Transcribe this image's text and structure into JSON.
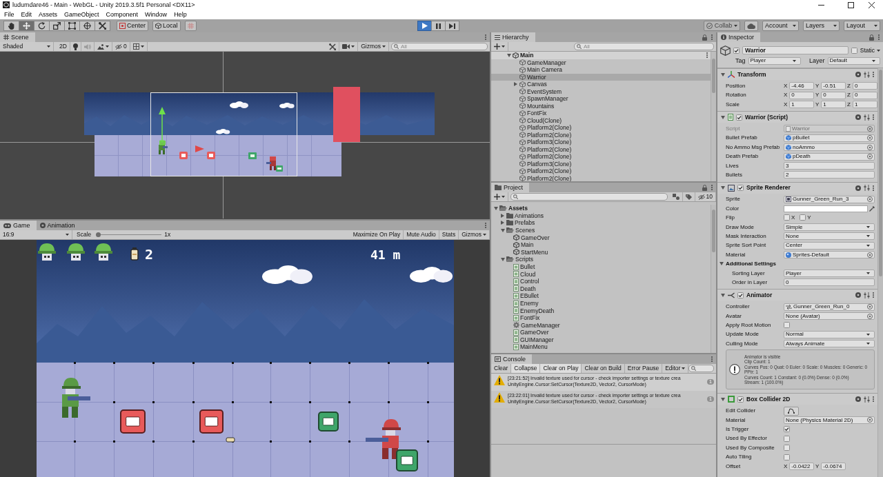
{
  "window": {
    "title": "ludumdare46 - Main - WebGL - Unity 2019.3.5f1 Personal <DX11>"
  },
  "menu": [
    "File",
    "Edit",
    "Assets",
    "GameObject",
    "Component",
    "Window",
    "Help"
  ],
  "toolbar": {
    "tools": [
      {
        "kind": "hand",
        "selected": false
      },
      {
        "kind": "move",
        "selected": true
      },
      {
        "kind": "rotate",
        "selected": false
      },
      {
        "kind": "scale",
        "selected": false
      },
      {
        "kind": "rect",
        "selected": false
      },
      {
        "kind": "transform",
        "selected": false
      },
      {
        "kind": "custom",
        "selected": false
      }
    ],
    "pivot": "Center",
    "space": "Local",
    "playback": [
      {
        "kind": "play",
        "on": true
      },
      {
        "kind": "pause",
        "on": false
      },
      {
        "kind": "step",
        "on": false
      }
    ],
    "collab": {
      "label": "Collab",
      "disabled": true
    },
    "account": "Account",
    "layers": "Layers",
    "layout": "Layout"
  },
  "scene": {
    "tab": "Scene",
    "shading": "Shaded",
    "mode_2d": "2D",
    "lighting": {
      "on": true
    },
    "audio": {
      "on": false
    },
    "hidden_count": "0",
    "gizmos": "Gizmos",
    "search_placeholder": "All"
  },
  "game": {
    "tabs": [
      {
        "label": "Game",
        "selected": true
      },
      {
        "label": "Animation",
        "selected": false
      }
    ],
    "aspect": "16:9",
    "scale_label": "Scale",
    "scale": {
      "level": 0
    },
    "scale_reading": "1x",
    "toggles": [
      {
        "label": "Maximize On Play",
        "on": false
      },
      {
        "label": "Mute Audio",
        "on": false
      },
      {
        "label": "Stats",
        "on": false
      }
    ],
    "gizmos": "Gizmos",
    "hud": {
      "ammo": "2",
      "distance": "41 m"
    }
  },
  "hierarchy": {
    "tab": "Hierarchy",
    "search_placeholder": "All",
    "items": [
      {
        "kind": "scene",
        "label": "Main",
        "expanded": true,
        "selected": false,
        "children": [
          {
            "kind": "object",
            "label": "GameManager",
            "selected": false
          },
          {
            "kind": "object",
            "label": "Main Camera",
            "selected": false
          },
          {
            "kind": "object",
            "label": "Warrior",
            "selected": true
          },
          {
            "kind": "object",
            "label": "Canvas",
            "expanded": false,
            "selected": false
          },
          {
            "kind": "object",
            "label": "EventSystem",
            "selected": false
          },
          {
            "kind": "object",
            "label": "SpawnManager",
            "selected": false
          },
          {
            "kind": "object",
            "label": "Mountains",
            "selected": false
          },
          {
            "kind": "object",
            "label": "FontFix",
            "selected": false
          },
          {
            "kind": "object",
            "label": "Cloud(Clone)",
            "selected": false
          },
          {
            "kind": "object",
            "label": "Platform2(Clone)",
            "selected": false
          },
          {
            "kind": "object",
            "label": "Platform2(Clone)",
            "selected": false
          },
          {
            "kind": "object",
            "label": "Platform3(Clone)",
            "selected": false
          },
          {
            "kind": "object",
            "label": "Platform2(Clone)",
            "selected": false
          },
          {
            "kind": "object",
            "label": "Platform2(Clone)",
            "selected": false
          },
          {
            "kind": "object",
            "label": "Platform3(Clone)",
            "selected": false
          },
          {
            "kind": "object",
            "label": "Platform2(Clone)",
            "selected": false
          },
          {
            "kind": "object",
            "label": "Platform2(Clone)",
            "selected": false
          }
        ]
      }
    ]
  },
  "project": {
    "tab": "Project",
    "hidden_count": "10",
    "items": [
      {
        "kind": "folder",
        "label": "Assets",
        "expanded": true,
        "children": [
          {
            "kind": "folder",
            "label": "Animations",
            "expanded": false
          },
          {
            "kind": "folder",
            "label": "Prefabs",
            "expanded": false
          },
          {
            "kind": "folder",
            "label": "Scenes",
            "expanded": true,
            "children": [
              {
                "kind": "scene",
                "label": "GameOver"
              },
              {
                "kind": "scene",
                "label": "Main"
              },
              {
                "kind": "scene",
                "label": "StartMenu"
              }
            ]
          },
          {
            "kind": "folder",
            "label": "Scripts",
            "expanded": true,
            "children": [
              {
                "kind": "script",
                "label": "Bullet"
              },
              {
                "kind": "script",
                "label": "Cloud"
              },
              {
                "kind": "script",
                "label": "Control"
              },
              {
                "kind": "script",
                "label": "Death"
              },
              {
                "kind": "script",
                "label": "EBullet"
              },
              {
                "kind": "script",
                "label": "Enemy"
              },
              {
                "kind": "script",
                "label": "EnemyDeath"
              },
              {
                "kind": "script",
                "label": "FontFix"
              },
              {
                "kind": "manager",
                "label": "GameManager"
              },
              {
                "kind": "script",
                "label": "GameOver"
              },
              {
                "kind": "script",
                "label": "GUIManager"
              },
              {
                "kind": "script",
                "label": "MainMenu"
              }
            ]
          }
        ]
      }
    ]
  },
  "console": {
    "tab": "Console",
    "buttons": [
      {
        "label": "Clear",
        "on": false
      },
      {
        "label": "Collapse",
        "on": true
      },
      {
        "label": "Clear on Play",
        "on": true
      },
      {
        "label": "Clear on Build",
        "on": false
      },
      {
        "label": "Error Pause",
        "on": false
      }
    ],
    "filter": "Editor",
    "messages": [
      {
        "kind": "warning",
        "text": "[23:21:52] Invalid texture used for cursor - check importer settings or texture crea",
        "trace": "UnityEngine.Cursor:SetCursor(Texture2D, Vector2, CursorMode)",
        "count": "1"
      },
      {
        "kind": "warning",
        "text": "[23:22:01] Invalid texture used for cursor - check importer settings or texture crea",
        "trace": "UnityEngine.Cursor:SetCursor(Texture2D, Vector2, CursorMode)",
        "count": "1"
      }
    ]
  },
  "inspector": {
    "tab": "Inspector",
    "object": {
      "active": true,
      "name": "Warrior",
      "static": false,
      "static_label": "Static",
      "tag_label": "Tag",
      "tag": "Player",
      "layer_label": "Layer",
      "layer": "Default"
    },
    "components": [
      {
        "kind": "transform",
        "title": "Transform",
        "expanded": true,
        "fields": [
          {
            "kind": "vector",
            "label": "Position",
            "parts": [
              {
                "axis": "X",
                "value": "-4.46"
              },
              {
                "axis": "Y",
                "value": "-0.51"
              },
              {
                "axis": "Z",
                "value": "0"
              }
            ]
          },
          {
            "kind": "vector",
            "label": "Rotation",
            "parts": [
              {
                "axis": "X",
                "value": "0"
              },
              {
                "axis": "Y",
                "value": "0"
              },
              {
                "axis": "Z",
                "value": "0"
              }
            ]
          },
          {
            "kind": "vector",
            "label": "Scale",
            "parts": [
              {
                "axis": "X",
                "value": "1"
              },
              {
                "axis": "Y",
                "value": "1"
              },
              {
                "axis": "Z",
                "value": "1"
              }
            ]
          }
        ]
      },
      {
        "kind": "script",
        "title": "Warrior (Script)",
        "enabled": true,
        "expanded": true,
        "fields": [
          {
            "kind": "object",
            "label": "Script",
            "ref": {
              "kind": "script",
              "name": "Warrior"
            },
            "disabled": true
          },
          {
            "kind": "object",
            "label": "Bullet Prefab",
            "ref": {
              "kind": "prefab",
              "name": "pBullet"
            },
            "disabled": false
          },
          {
            "kind": "object",
            "label": "No Ammo Msg Prefab",
            "ref": {
              "kind": "prefab",
              "name": "noAmmo"
            },
            "disabled": false
          },
          {
            "kind": "object",
            "label": "Death Prefab",
            "ref": {
              "kind": "prefab",
              "name": "pDeath"
            },
            "disabled": false
          },
          {
            "kind": "text",
            "label": "Lives",
            "value": "3"
          },
          {
            "kind": "text",
            "label": "Bullets",
            "value": "2"
          }
        ]
      },
      {
        "kind": "sprite",
        "title": "Sprite Renderer",
        "enabled": true,
        "expanded": true,
        "fields": [
          {
            "kind": "object",
            "label": "Sprite",
            "ref": {
              "kind": "sprite",
              "name": "Gunner_Green_Run_3"
            },
            "disabled": false
          },
          {
            "kind": "color",
            "label": "Color",
            "color": "#ffffff"
          },
          {
            "kind": "flip",
            "label": "Flip",
            "options": [
              {
                "label": "X",
                "checked": false
              },
              {
                "label": "Y",
                "checked": false
              }
            ]
          },
          {
            "kind": "dropdown",
            "label": "Draw Mode",
            "value": "Simple"
          },
          {
            "kind": "dropdown",
            "label": "Mask Interaction",
            "value": "None"
          },
          {
            "kind": "dropdown",
            "label": "Sprite Sort Point",
            "value": "Center"
          },
          {
            "kind": "object",
            "label": "Material",
            "ref": {
              "kind": "material",
              "name": "Sprites-Default"
            },
            "disabled": false
          },
          {
            "kind": "foldout",
            "label": "Additional Settings",
            "expanded": true,
            "children": [
              {
                "kind": "dropdown",
                "label": "Sorting Layer",
                "value": "Player"
              },
              {
                "kind": "text",
                "label": "Order in Layer",
                "value": "0"
              }
            ]
          }
        ]
      },
      {
        "kind": "animator",
        "title": "Animator",
        "enabled": true,
        "expanded": true,
        "fields": [
          {
            "kind": "object",
            "label": "Controller",
            "ref": {
              "kind": "controller",
              "name": "Gunner_Green_Run_0"
            },
            "disabled": false
          },
          {
            "kind": "object",
            "label": "Avatar",
            "ref": {
              "kind": "none",
              "name": "None (Avatar)"
            },
            "disabled": false
          },
          {
            "kind": "checkbox",
            "label": "Apply Root Motion",
            "checked": false
          },
          {
            "kind": "dropdown",
            "label": "Update Mode",
            "value": "Normal"
          },
          {
            "kind": "dropdown",
            "label": "Culling Mode",
            "value": "Always Animate"
          },
          {
            "kind": "info",
            "lines": [
              "Animator is visible",
              "Clip Count: 1",
              "Curves Pos: 0 Quat: 0 Euler: 0 Scale: 0 Muscles: 0 Generic: 0 PPtr: 1",
              "Curves Count: 1 Constant: 0 (0.0%) Dense: 0 (0.0%)",
              "Stream: 1 (100.0%)"
            ]
          }
        ]
      },
      {
        "kind": "collider",
        "title": "Box Collider 2D",
        "enabled": true,
        "expanded": true,
        "fields": [
          {
            "kind": "button",
            "label": "Edit Collider"
          },
          {
            "kind": "object",
            "label": "Material",
            "ref": {
              "kind": "none",
              "name": "None (Physics Material 2D)"
            },
            "disabled": false
          },
          {
            "kind": "checkbox",
            "label": "Is Trigger",
            "checked": true
          },
          {
            "kind": "checkbox",
            "label": "Used By Effector",
            "checked": false
          },
          {
            "kind": "checkbox",
            "label": "Used By Composite",
            "checked": false
          },
          {
            "kind": "checkbox",
            "label": "Auto Tiling",
            "checked": false
          },
          {
            "kind": "vector",
            "label": "Offset",
            "parts": [
              {
                "axis": "X",
                "value": "-0.0422"
              },
              {
                "axis": "Y",
                "value": "-0.0674"
              }
            ]
          }
        ]
      }
    ]
  }
}
